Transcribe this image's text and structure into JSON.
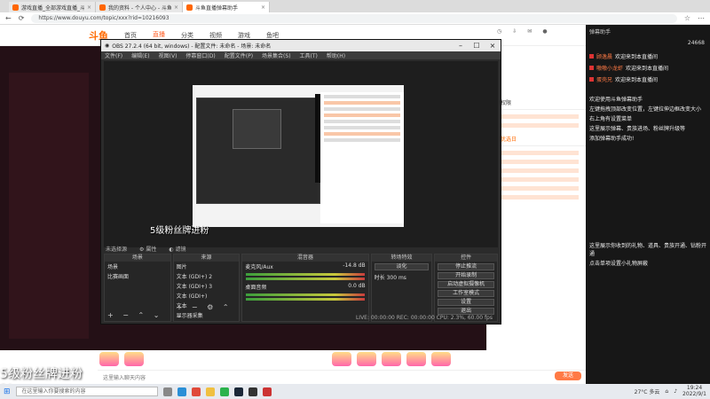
{
  "browser": {
    "tabs": [
      {
        "label": "游戏直播_全部游戏直播_斗鱼直播"
      },
      {
        "label": "我的资料 - 个人中心 - 斗鱼"
      },
      {
        "label": "斗鱼直播弹幕助手"
      }
    ],
    "url": "https://www.douyu.com/topic/xxx?rid=10216093"
  },
  "site": {
    "logo": "斗鱼",
    "nav": [
      "首页",
      "直播",
      "分类",
      "视频",
      "游戏",
      "鱼吧"
    ]
  },
  "obs": {
    "title": "OBS 27.2.4 (64 bit, windows) - 配置文件: 未命名 - 场景: 未命名",
    "menu": [
      "文件(F)",
      "编辑(E)",
      "视图(V)",
      "停靠窗口(D)",
      "配置文件(P)",
      "场景集合(S)",
      "工具(T)",
      "帮助(H)"
    ],
    "scene_tabs": [
      "未选择源",
      "属性",
      "滤镜"
    ],
    "docks": {
      "scenes": {
        "title": "场景",
        "items": [
          "场景",
          "比赛画面"
        ]
      },
      "sources": {
        "title": "来源",
        "items": [
          "图片",
          "文本 (GDI+) 2",
          "文本 (GDI+) 3",
          "文本 (GDI+)",
          "文本",
          "显示器采集"
        ]
      },
      "mixer": {
        "title": "混音器",
        "tracks": [
          {
            "name": "麦克风/Aux",
            "db": "-14.8 dB"
          },
          {
            "name": "桌面音频",
            "db": "0.0 dB"
          }
        ]
      },
      "transitions": {
        "title": "转场特效",
        "type": "淡化",
        "duration_label": "时长",
        "duration": "300 ms"
      },
      "controls": {
        "title": "控件",
        "buttons": [
          "停止推流",
          "开始录制",
          "启动虚拟摄像机",
          "工作室模式",
          "设置",
          "退出"
        ]
      }
    },
    "status": "LIVE: 00:00:00    REC: 00:00:00    CPU: 2.3%, 60.00 fps",
    "preview_caption": "5级粉丝牌进粉"
  },
  "chat_column": {
    "headers": [
      "主播权限",
      "钻粉优选日"
    ]
  },
  "right_panel": {
    "title": "弹幕助手",
    "count": "24668",
    "entries": [
      {
        "user": "顾逸晨",
        "text": "欢迎来到本直播间"
      },
      {
        "user": "嗷嗷小龙虾",
        "text": "欢迎来到本直播间"
      },
      {
        "user": "蛋壳兄",
        "text": "欢迎来到本直播间"
      }
    ],
    "lines": [
      "欢迎使用斗鱼弹幕助手",
      "左键拖拽顶部改变位置，左键拉伸边框改变大小",
      "右上角有设置菜单",
      "这里展示弹幕、贵族进场、粉丝牌升级等",
      "添加弹幕助手成功!",
      "这里展示你收到的礼物、道具、贵族开通、钻粉开通",
      "点击单项设置小礼物屏蔽"
    ]
  },
  "overlay": {
    "big": "5级粉丝牌进粉",
    "small": "24"
  },
  "input": {
    "placeholder": "这里输入聊天内容"
  },
  "send_label": "发送",
  "taskbar": {
    "search": "在这里输入你要搜索的内容",
    "weather": "27°C 多云",
    "time": "19:24",
    "date": "2022/9/1"
  }
}
